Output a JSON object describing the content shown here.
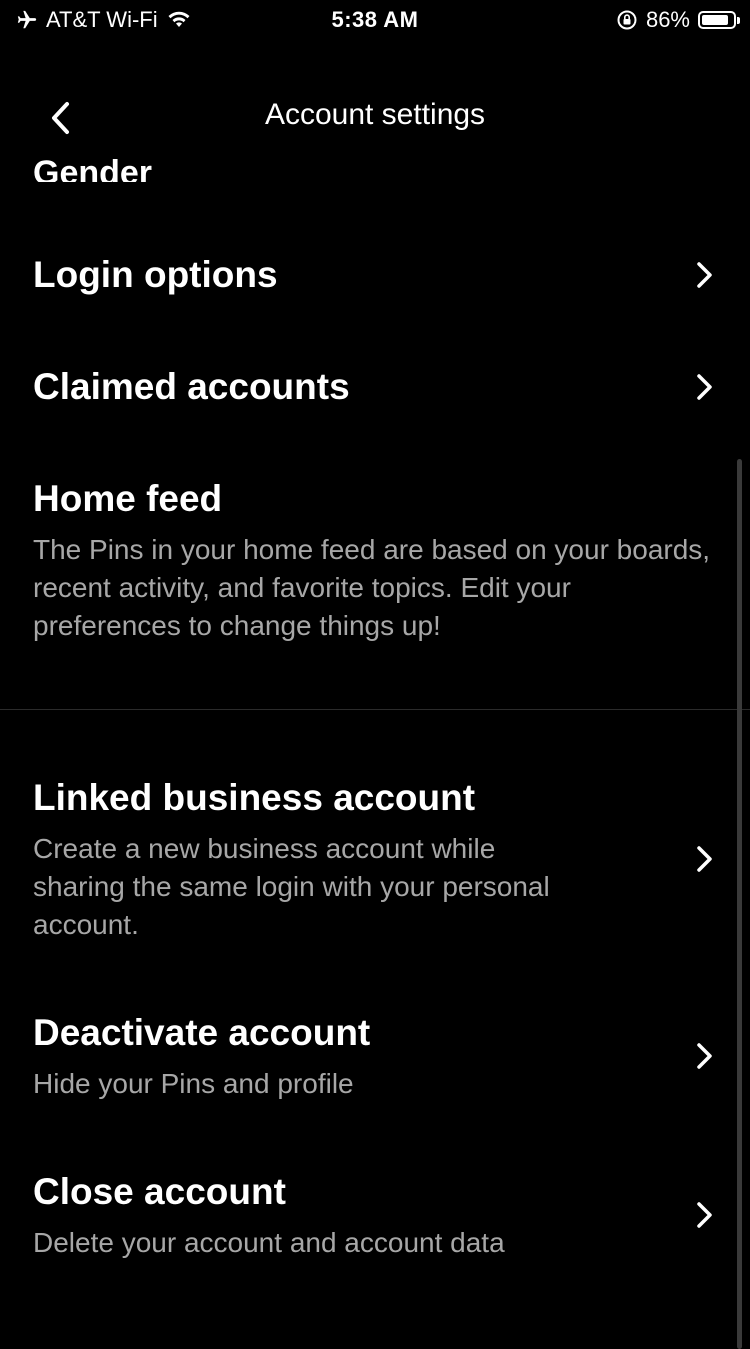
{
  "status_bar": {
    "carrier": "AT&T Wi-Fi",
    "time": "5:38 AM",
    "battery": "86%",
    "battery_level": 0.86,
    "icons": [
      "airplane-icon",
      "wifi-icon",
      "orientation-lock-icon",
      "battery-icon"
    ]
  },
  "header": {
    "title": "Account settings",
    "back_icon": "chevron-left-icon"
  },
  "partial_item": {
    "title": "Gender"
  },
  "items": [
    {
      "title": "Login options",
      "chevron": true
    },
    {
      "title": "Claimed accounts",
      "chevron": true
    },
    {
      "title": "Home feed",
      "description": "The Pins in your home feed are based on your boards, recent activity, and favorite topics. Edit your preferences to change things up!",
      "chevron": false
    },
    {
      "title": "Linked business account",
      "description": "Create a new business account while sharing the same login with your personal account.",
      "chevron": true
    },
    {
      "title": "Deactivate account",
      "description": "Hide your Pins and profile",
      "chevron": true
    },
    {
      "title": "Close account",
      "description": "Delete your account and account data",
      "chevron": true
    }
  ],
  "colors": {
    "background": "#000000",
    "primary_text": "#ffffff",
    "secondary_text": "#a7a7a7",
    "divider": "#2b2b2b"
  }
}
